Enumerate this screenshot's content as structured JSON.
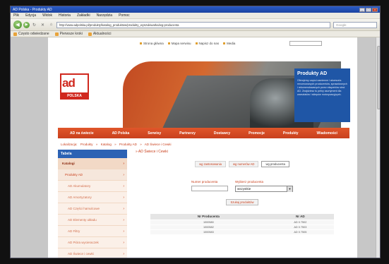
{
  "window": {
    "title": "AD Polska - Produkty AD",
    "controls": [
      "_",
      "□",
      "×"
    ]
  },
  "menu": [
    "Plik",
    "Edycja",
    "Widok",
    "Historia",
    "Zakładki",
    "Narzędzia",
    "Pomoc"
  ],
  "toolbar": {
    "url": "http://www.adpolska.pl/produkty/katalog_produktow/produkty_wyszukiwarka/wg-producenta",
    "search_placeholder": "Google"
  },
  "bookmarks": [
    "Często odwiedzane",
    "Pierwsze kroki",
    "Aktualności"
  ],
  "site": {
    "top_links": [
      "Strona główna",
      "Mapa serwisu",
      "Napisz do nas",
      "Media"
    ],
    "logo_letters": "ad",
    "logo_country": "POLSKA",
    "hero_heading": "Produkty AD",
    "hero_text": "Oferujemy części zamienne i akcesoria renomowanych producentów, sprawdzonych i rekomendowanych przez ekspertów sieci AD. Znajdziesz tu pełny asortyment dla warsztatów i sklepów motoryzacyjnych.",
    "main_nav": [
      "AD na świecie",
      "AD Polska",
      "Serwisy",
      "Partnerzy",
      "Dostawcy",
      "Promocje",
      "Produkty",
      "Wiadomości"
    ],
    "breadcrumb": [
      "Lokalizacja:",
      "Produkty",
      "»",
      "Katalog",
      "»",
      "Produkty AD",
      "»",
      "AD Świece i Cewki"
    ]
  },
  "sidebar": {
    "heading": "Tabela",
    "items": [
      {
        "label": "Katalogi",
        "level": 0
      },
      {
        "label": "Produkty AD",
        "level": 1
      },
      {
        "label": "AD Akumulatory",
        "level": 2
      },
      {
        "label": "AD Amortyzatory",
        "level": 2
      },
      {
        "label": "AD Części hamulcowe",
        "level": 2
      },
      {
        "label": "AD Elementy układu",
        "level": 2
      },
      {
        "label": "AD Filtry",
        "level": 2
      },
      {
        "label": "AD Pióra wycieraczek",
        "level": 2
      },
      {
        "label": "AD Świece i cewki",
        "level": 2
      }
    ]
  },
  "main": {
    "section_title": "» AD Świece i Cewki",
    "tabs": [
      {
        "label": "wg zastosowania",
        "active": false
      },
      {
        "label": "wg numerów AD",
        "active": false
      },
      {
        "label": "wg producenta",
        "active": true
      }
    ],
    "filter_number_label": "Numer producenta",
    "filter_producer_label": "Wybierz producenta",
    "filter_producer_value": "wszystkie",
    "find_button": "Szukaj produktów",
    "results_headers": [
      "Nr Producenta",
      "Nr AD"
    ],
    "results_rows": [
      [
        "1000580",
        "AD 0 7502"
      ],
      [
        "1000582",
        "AD 0 7503"
      ],
      [
        "1000583",
        "AD 0 7505"
      ]
    ]
  }
}
